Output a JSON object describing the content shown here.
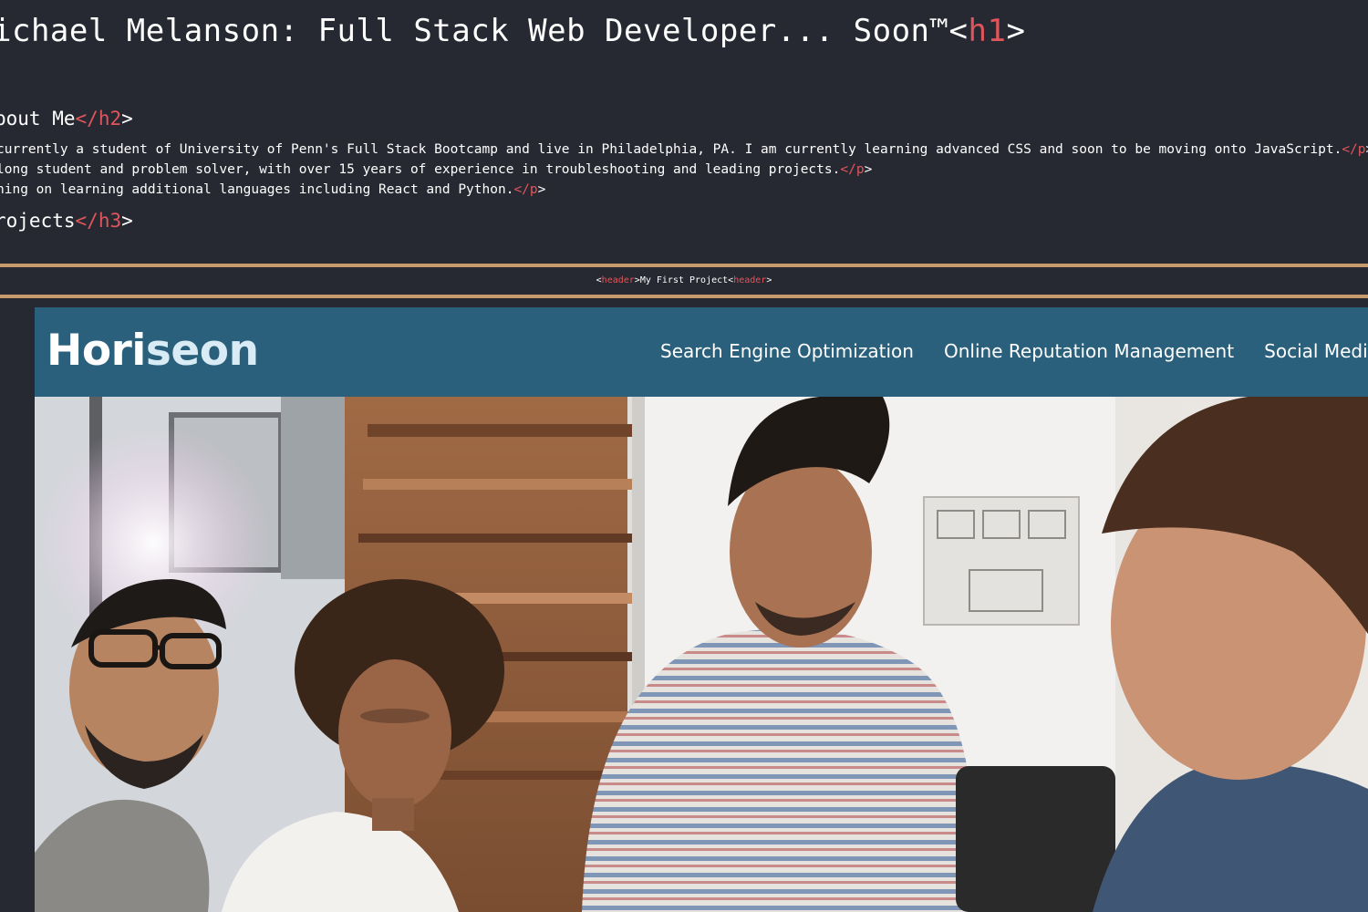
{
  "heading": {
    "text": "ichael Melanson: Full Stack Web Developer... Soon™",
    "close_open": "<",
    "close_tag": "h1",
    "close_end": ">"
  },
  "about": {
    "text": "bout Me",
    "close_open": "</",
    "close_tag": "h2",
    "close_end": ">"
  },
  "paragraphs": [
    {
      "text": " currently a student of University of Penn's Full Stack Bootcamp and live in Philadelphia, PA. I am currently learning advanced CSS and soon to be moving onto JavaScript.",
      "close_open": "</",
      "close_tag": "p",
      "close_end": ">"
    },
    {
      "text": "long student and problem solver, with over 15 years of experience in troubleshooting and leading projects.",
      "close_open": "</",
      "close_tag": "p",
      "close_end": ">"
    },
    {
      "text": "ning on learning additional languages including React and Python.",
      "close_open": "</",
      "close_tag": "p",
      "close_end": ">"
    }
  ],
  "projects": {
    "text": "rojects",
    "close_open": "</",
    "close_tag": "h3",
    "close_end": ">"
  },
  "project_header": {
    "open_a": "<",
    "tag_a": "header",
    "open_b": ">",
    "title": "My First Project",
    "close_a": "<",
    "tag_b": "header",
    "close_b": ">"
  },
  "horiseon": {
    "brand_part1": "Hori",
    "brand_part2": "seon",
    "nav": [
      "Search Engine Optimization",
      "Online Reputation Management",
      "Social Media Marketing"
    ]
  },
  "colors": {
    "page_bg": "#262932",
    "tag_red": "#e0555b",
    "rule_tan": "#c69a6a",
    "nav_blue": "#2a607c"
  }
}
